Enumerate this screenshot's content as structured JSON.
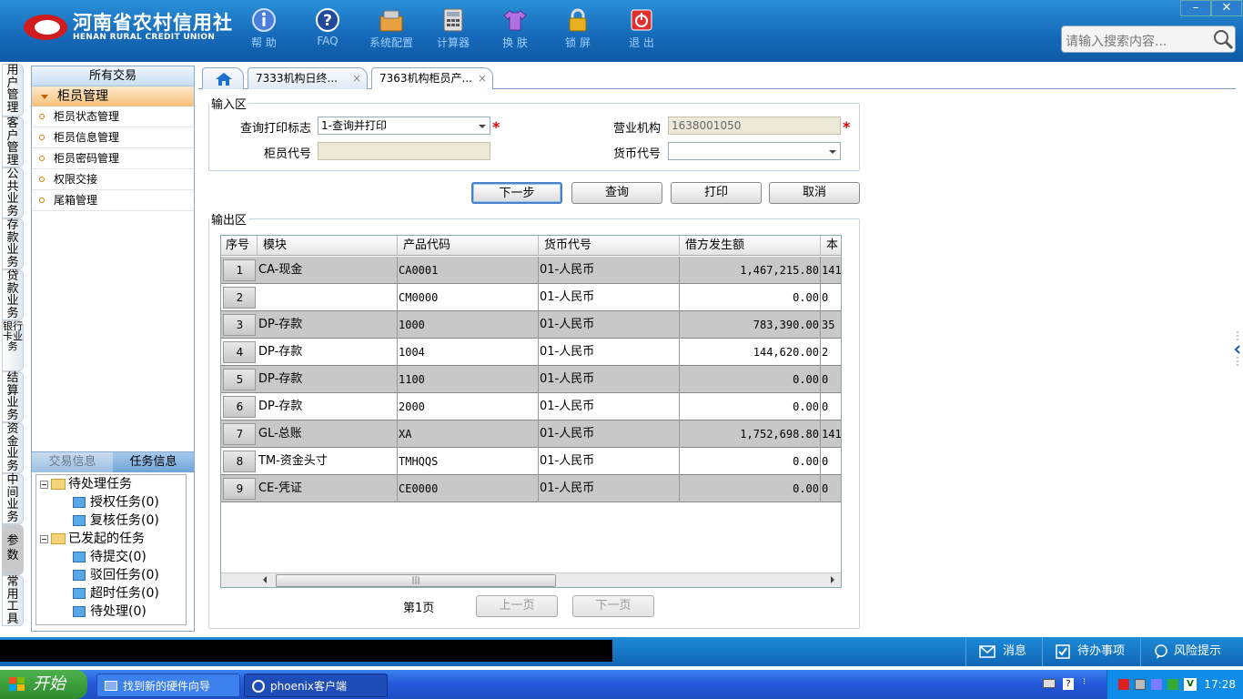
{
  "header": {
    "logo_cn": "河南省农村信用社",
    "logo_en": "HENAN RURAL CREDIT UNION",
    "toolbar": [
      {
        "label": "帮  助",
        "icon": "info-icon"
      },
      {
        "label": "FAQ",
        "icon": "question-icon"
      },
      {
        "label": "系统配置",
        "icon": "config-icon"
      },
      {
        "label": "计算器",
        "icon": "calculator-icon"
      },
      {
        "label": "换  肤",
        "icon": "shirt-icon"
      },
      {
        "label": "锁  屏",
        "icon": "lock-icon"
      },
      {
        "label": "退  出",
        "icon": "power-icon"
      }
    ],
    "search_placeholder": "请输入搜索内容...",
    "min_label": "–",
    "close_label": "✕"
  },
  "vnav": [
    "用户管理",
    "客户管理",
    "公共业务",
    "存款业务",
    "贷款业务",
    "银行卡业务",
    "结算业务",
    "资金业务",
    "中间业务",
    "参数",
    "常用工具"
  ],
  "left": {
    "header": "所有交易",
    "group": "柜员管理",
    "items": [
      "柜员状态管理",
      "柜员信息管理",
      "柜员密码管理",
      "权限交接",
      "尾箱管理"
    ]
  },
  "tasks": {
    "tab_trans": "交易信息",
    "tab_task": "任务信息",
    "tree": {
      "pending": "待处理任务",
      "auth": "授权任务(0)",
      "review": "复核任务(0)",
      "initiated": "已发起的任务",
      "to_submit": "待提交(0)",
      "rejected": "驳回任务(0)",
      "timeout": "超时任务(0)",
      "to_process": "待处理(0)"
    }
  },
  "tabs": {
    "t1": "7333机构日终...",
    "t2": "7363机构柜员产...",
    "close": "×"
  },
  "input": {
    "legend": "输入区",
    "print_flag_label": "查询打印标志",
    "print_flag_value": "1-查询并打印",
    "org_label": "营业机构",
    "org_value": "1638001050",
    "teller_label": "柜员代号",
    "teller_value": "",
    "currency_label": "货币代号",
    "currency_value": "",
    "req": "*"
  },
  "buttons": {
    "next": "下一步",
    "query": "查询",
    "print": "打印",
    "cancel": "取消"
  },
  "output": {
    "legend": "输出区",
    "headers": [
      "序号",
      "模块",
      "产品代码",
      "货币代号",
      "借方发生额",
      "本"
    ],
    "rows": [
      {
        "sn": "1",
        "module": "CA-现金",
        "code": "CA0001",
        "currency": "01-人民币",
        "debit": "1,467,215.80",
        "extra": "141"
      },
      {
        "sn": "2",
        "module": "",
        "code": "CM0000",
        "currency": "01-人民币",
        "debit": "0.00",
        "extra": "0"
      },
      {
        "sn": "3",
        "module": "DP-存款",
        "code": "1000",
        "currency": "01-人民币",
        "debit": "783,390.00",
        "extra": "35"
      },
      {
        "sn": "4",
        "module": "DP-存款",
        "code": "1004",
        "currency": "01-人民币",
        "debit": "144,620.00",
        "extra": "2"
      },
      {
        "sn": "5",
        "module": "DP-存款",
        "code": "1100",
        "currency": "01-人民币",
        "debit": "0.00",
        "extra": "0"
      },
      {
        "sn": "6",
        "module": "DP-存款",
        "code": "2000",
        "currency": "01-人民币",
        "debit": "0.00",
        "extra": "0"
      },
      {
        "sn": "7",
        "module": "GL-总账",
        "code": "XA",
        "currency": "01-人民币",
        "debit": "1,752,698.80",
        "extra": "141"
      },
      {
        "sn": "8",
        "module": "TM-资金头寸",
        "code": "TMHQQS",
        "currency": "01-人民币",
        "debit": "0.00",
        "extra": "0"
      },
      {
        "sn": "9",
        "module": "CE-凭证",
        "code": "CE0000",
        "currency": "01-人民币",
        "debit": "0.00",
        "extra": "0"
      }
    ],
    "page_label": "第1页",
    "prev": "上一页",
    "next": "下一页",
    "scroll_grip": "|||"
  },
  "footer": {
    "msg": "消息",
    "todo": "待办事项",
    "risk": "风险提示"
  },
  "taskbar": {
    "start": "开始",
    "task1": "找到新的硬件向导",
    "task2": "phoenix客户端",
    "clock": "17:28"
  }
}
